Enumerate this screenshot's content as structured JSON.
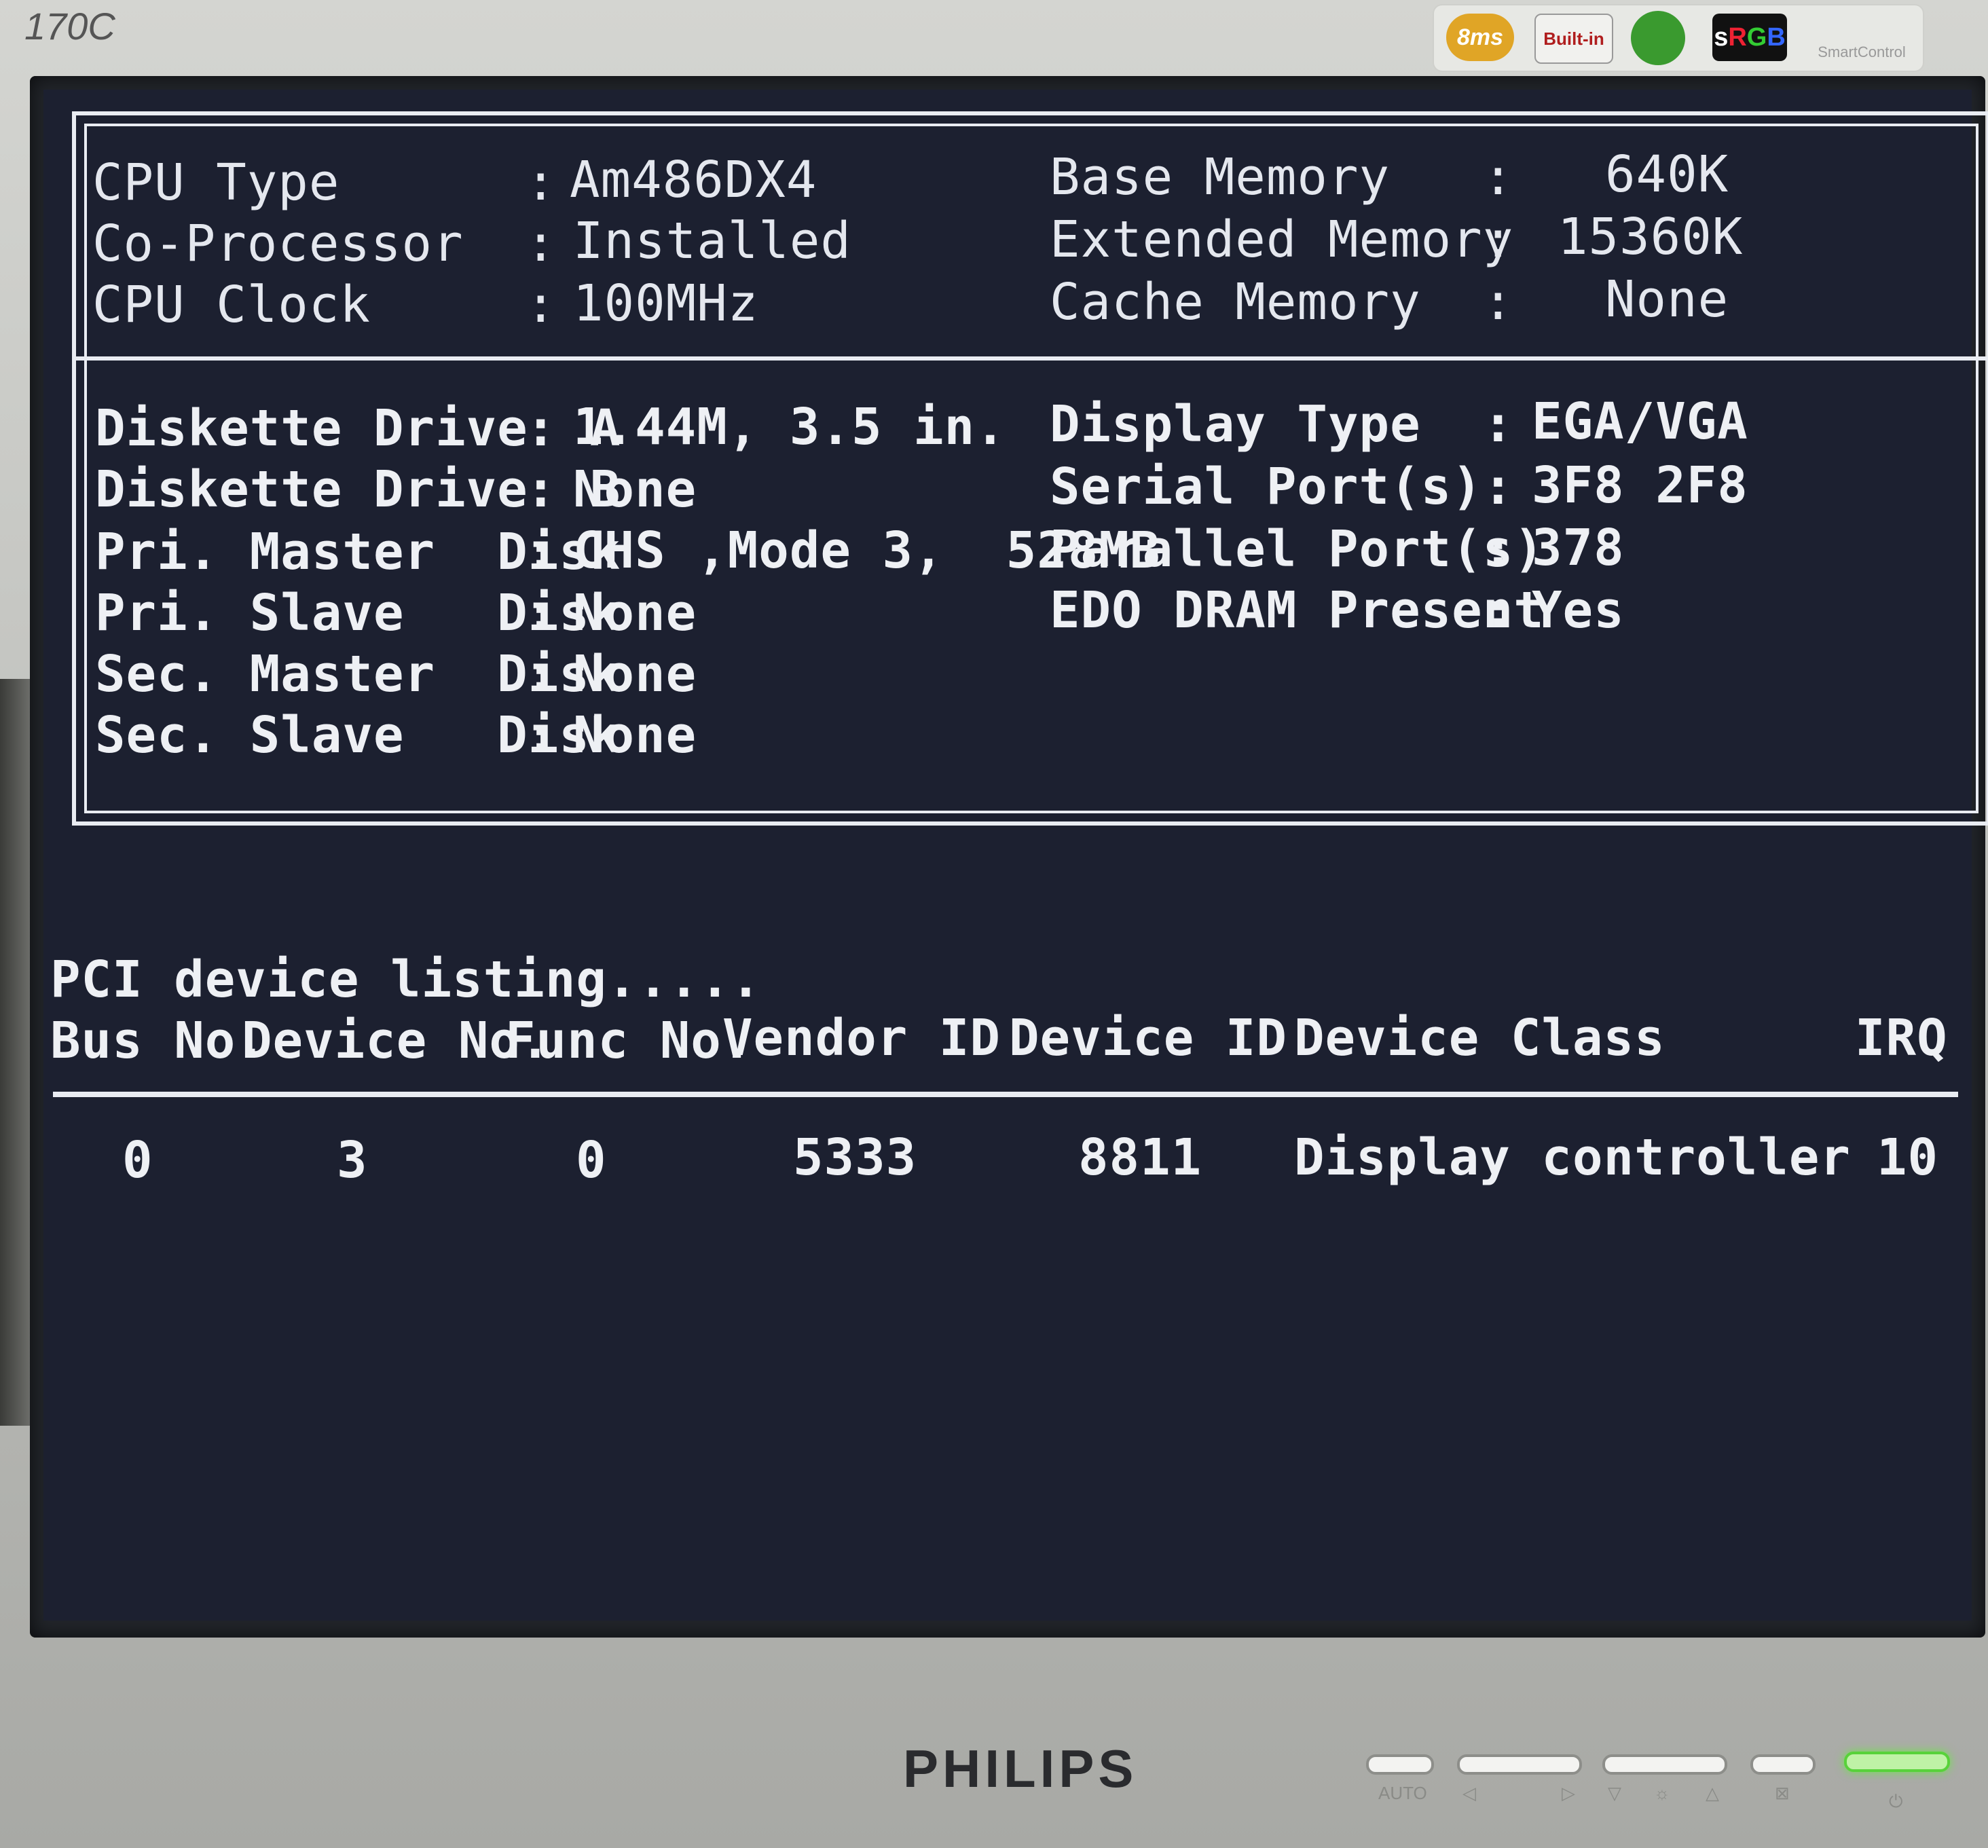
{
  "monitor": {
    "model": "170C",
    "brand": "PHILIPS",
    "badges": {
      "response": "8ms",
      "power": "Built-in",
      "srgb_s": "s",
      "srgb_r": "R",
      "srgb_g": "G",
      "srgb_b": "B",
      "smart": "SmartControl"
    },
    "controls": [
      "AUTO",
      "◁",
      "▷",
      "▽",
      "☼",
      "△",
      "⊠",
      "⏻"
    ]
  },
  "system": {
    "left": [
      {
        "label": "CPU Type",
        "value": "Am486DX4"
      },
      {
        "label": "Co-Processor",
        "value": "Installed"
      },
      {
        "label": "CPU Clock",
        "value": "100MHz"
      }
    ],
    "right": [
      {
        "label": "Base Memory",
        "value": "640K"
      },
      {
        "label": "Extended Memory",
        "value": "15360K"
      },
      {
        "label": "Cache Memory",
        "value": "None"
      }
    ]
  },
  "drives": [
    {
      "label": "Diskette Drive  A",
      "value": "1.44M, 3.5 in."
    },
    {
      "label": "Diskette Drive  B",
      "value": "None"
    },
    {
      "label": "Pri. Master  Disk",
      "value": "CHS ,Mode 3,  528MB"
    },
    {
      "label": "Pri. Slave   Disk",
      "value": "None"
    },
    {
      "label": "Sec. Master  Disk",
      "value": "None"
    },
    {
      "label": "Sec. Slave   Disk",
      "value": "None"
    }
  ],
  "peripherals": [
    {
      "label": "Display Type",
      "value": "EGA/VGA"
    },
    {
      "label": "Serial Port(s)",
      "value": "3F8 2F8"
    },
    {
      "label": "Parallel Port(s)",
      "value": "378"
    },
    {
      "label": "EDO DRAM Present",
      "value": "Yes"
    }
  ],
  "separator": ":",
  "pci": {
    "title": "PCI device listing.....",
    "headers": [
      "Bus No.",
      "Device No.",
      "Func No.",
      "Vendor ID",
      "Device ID",
      "Device Class",
      "IRQ"
    ],
    "rows": [
      [
        "0",
        "3",
        "0",
        "5333",
        "8811",
        "Display controller",
        "10"
      ]
    ]
  }
}
